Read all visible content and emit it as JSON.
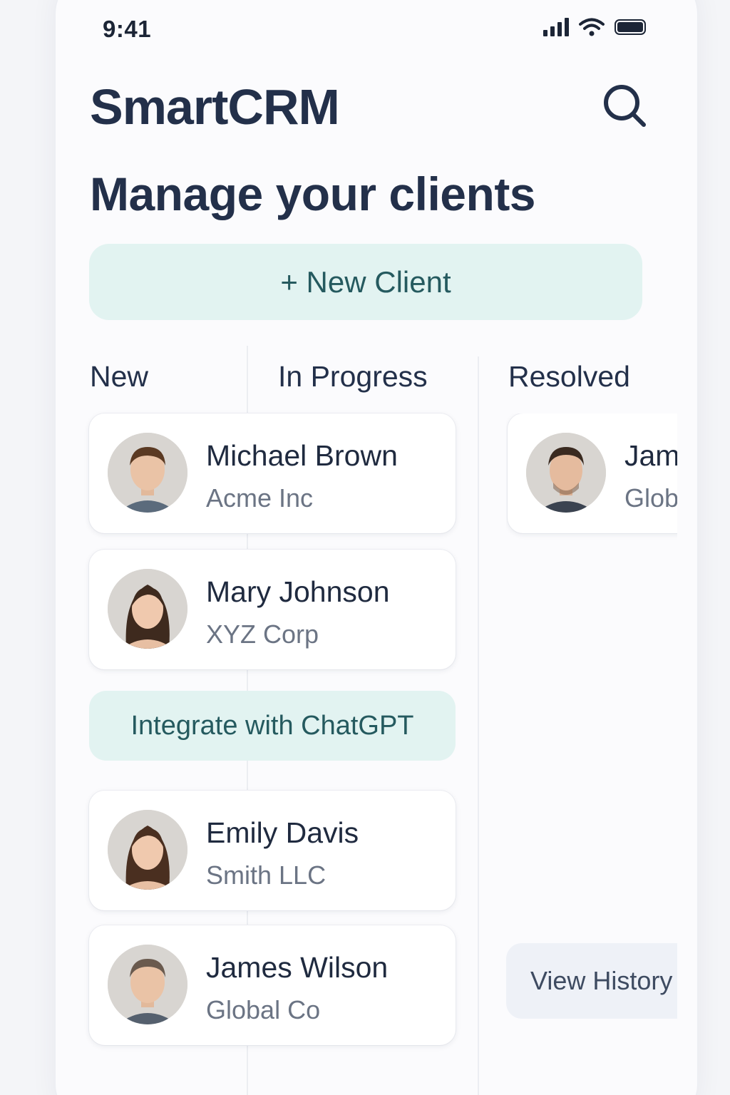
{
  "status_bar": {
    "time": "9:41"
  },
  "header": {
    "app_title": "SmartCRM",
    "search_icon": "search-icon"
  },
  "headline": "Manage your clients",
  "new_client_button": "+ New Client",
  "columns": [
    "New",
    "In Progress",
    "Resolved"
  ],
  "clients": [
    {
      "name": "Michael Brown",
      "company": "Acme Inc"
    },
    {
      "name": "Mary Johnson",
      "company": "XYZ Corp"
    },
    {
      "name": "Emily Davis",
      "company": "Smith LLC"
    },
    {
      "name": "James Wilson",
      "company": "Global Co"
    }
  ],
  "resolved_clients": [
    {
      "name": "James Wilson",
      "company": "Global Co"
    }
  ],
  "chatgpt_button": "Integrate with ChatGPT",
  "view_history_button": "View History",
  "colors": {
    "accent_bg": "#e2f3f1",
    "accent_text": "#255a5f",
    "title": "#23304a"
  }
}
